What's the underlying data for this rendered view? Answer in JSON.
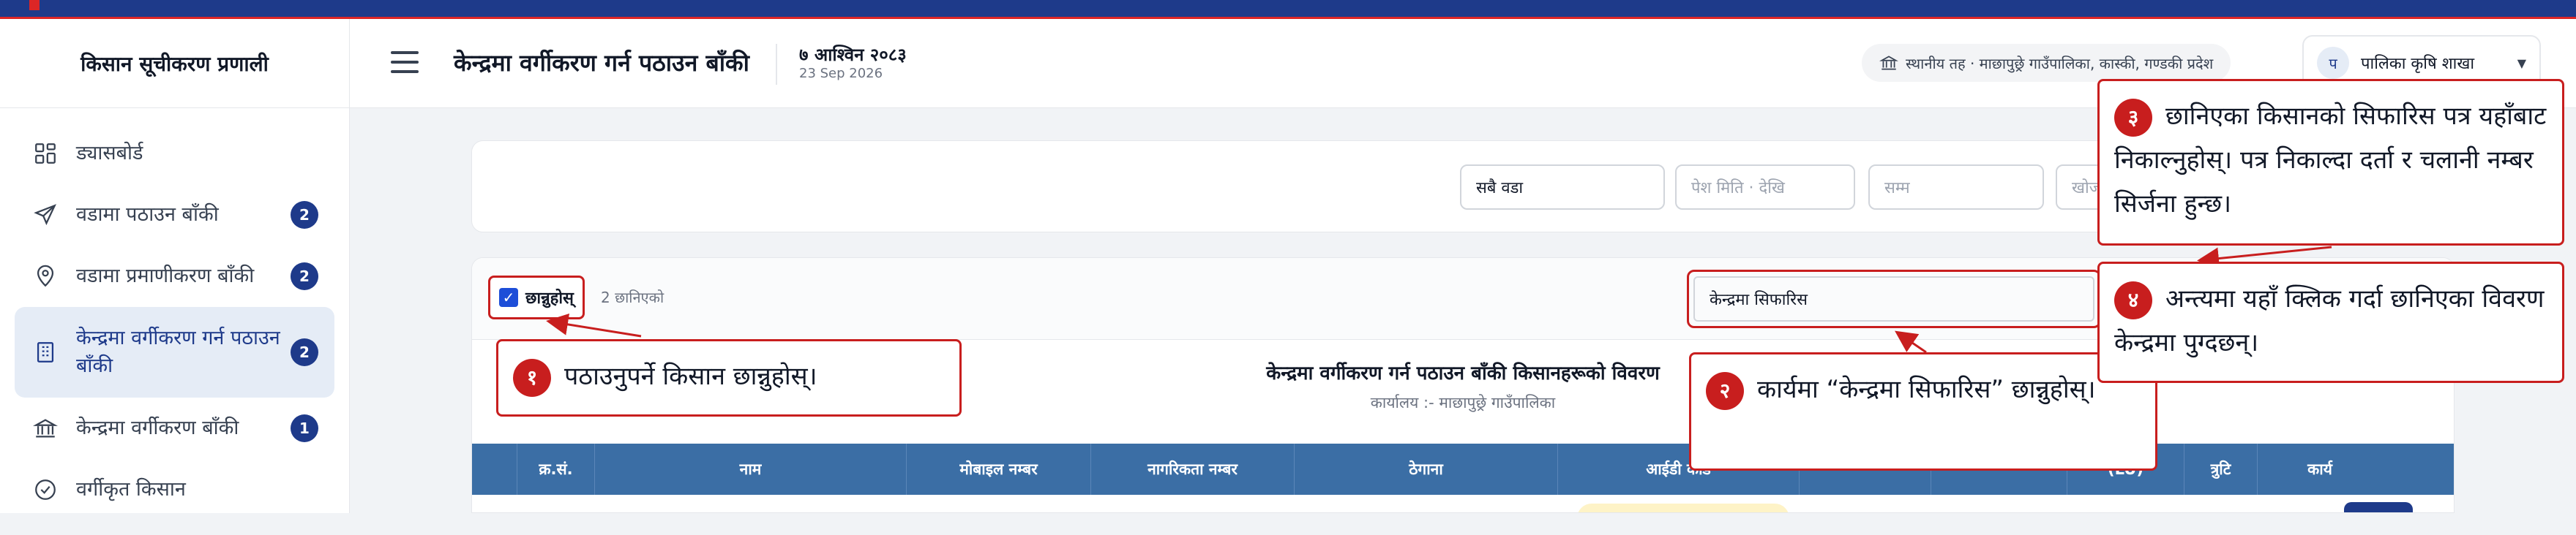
{
  "sidebar": {
    "brand": "किसान सूचीकरण प्रणाली",
    "items": [
      {
        "label": "ड्यासबोर्ड",
        "badge": ""
      },
      {
        "label": "वडामा पठाउन बाँकी",
        "badge": "2"
      },
      {
        "label": "वडामा प्रमाणीकरण बाँकी",
        "badge": "2"
      },
      {
        "label": "केन्द्रमा वर्गीकरण गर्न पठाउन बाँकी",
        "badge": "2"
      },
      {
        "label": "केन्द्रमा वर्गीकरण बाँकी",
        "badge": "1"
      },
      {
        "label": "वर्गीकृत किसान",
        "badge": ""
      }
    ]
  },
  "header": {
    "title": "केन्द्रमा वर्गीकरण गर्न पठाउन बाँकी",
    "date_np": "७ आश्विन २०८३",
    "date_en": "23 Sep 2026",
    "location": "स्थानीय तह · माछापुछ्रे गाउँपालिका, कास्की, गण्डकी प्रदेश",
    "user_initial": "प",
    "user_name": "पालिका कृषि शाखा"
  },
  "filters": {
    "ward": "सबै वडा",
    "date_from_placeholder": "पेश मिति · देखि",
    "date_to_placeholder": "सम्म",
    "search_placeholder": "खोज"
  },
  "table": {
    "select_all_label": "छान्नुहोस्",
    "selected_count": "2 छानिएको",
    "action_value": "केन्द्रमा सिफारिस",
    "report_title": "केन्द्रमा वर्गीकरण गर्न पठाउन बाँकी किसानहरूको विवरण",
    "report_office": "कार्यालय :- माछापुछ्रे गाउँपालिका",
    "columns": [
      "",
      "क्र.सं.",
      "नाम",
      "मोबाइल नम्बर",
      "नागरिकता नम्बर",
      "ठेगाना",
      "आईडी कार्ड",
      "",
      "",
      "(LU)",
      "त्रुटि",
      "कार्य"
    ]
  },
  "callouts": {
    "c1_num": "१",
    "c1_text": "पठाउनुपर्ने किसान छान्नुहोस्।",
    "c2_num": "२",
    "c2_text": "कार्यमा “केन्द्रमा सिफारिस” छान्नुहोस्।",
    "c3_num": "३",
    "c3_text": "छानिएका किसानको सिफारिस पत्र यहाँबाट निकाल्नुहोस्। पत्र निकाल्दा दर्ता र चलानी नम्बर सिर्जना हुन्छ।",
    "c4_num": "४",
    "c4_text": "अन्त्यमा यहाँ क्लिक गर्दा छानिएका विवरण केन्द्रमा पुग्दछन्।"
  },
  "colors": {
    "brand": "#1e3a8a",
    "accent": "#c81e1e",
    "table_header": "#3b6ea5"
  }
}
